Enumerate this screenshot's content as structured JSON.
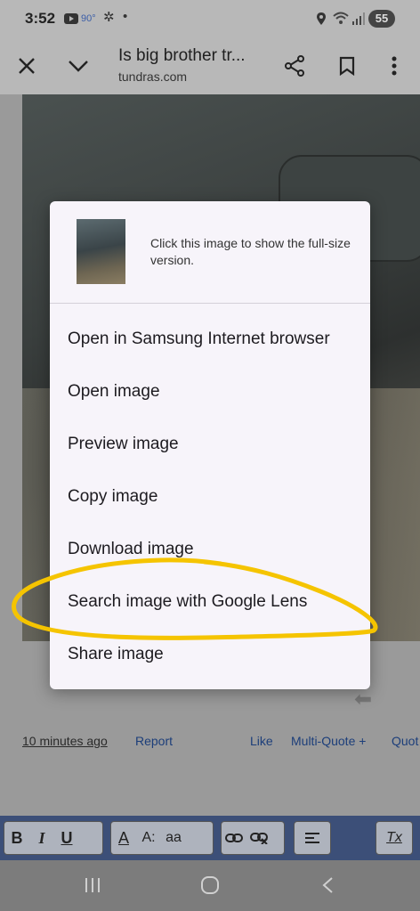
{
  "status_bar": {
    "time": "3:52",
    "temperature": "90°",
    "battery": "55"
  },
  "toolbar": {
    "title": "Is big brother tr...",
    "url": "tundras.com"
  },
  "dialog": {
    "hint": "Click this image to show the full-size version.",
    "items": [
      {
        "label": "Open in Samsung Internet browser"
      },
      {
        "label": "Open image"
      },
      {
        "label": "Preview image"
      },
      {
        "label": "Copy image"
      },
      {
        "label": "Download image"
      },
      {
        "label": "Search image with Google Lens"
      },
      {
        "label": "Share image"
      }
    ]
  },
  "post_footer": {
    "time_ago": "10 minutes ago",
    "report": "Report",
    "like": "Like",
    "multi_quote": "Multi-Quote +",
    "quote": "Quot"
  },
  "editor": {
    "bold": "B",
    "italic": "I",
    "underline": "U",
    "text_color": "A",
    "font_size": "A:",
    "font_family": "aa",
    "clear_format": "Tx"
  },
  "colors": {
    "highlight": "#f5c400",
    "link": "#1c3e7a",
    "dialog_bg": "#f7f4fa"
  }
}
